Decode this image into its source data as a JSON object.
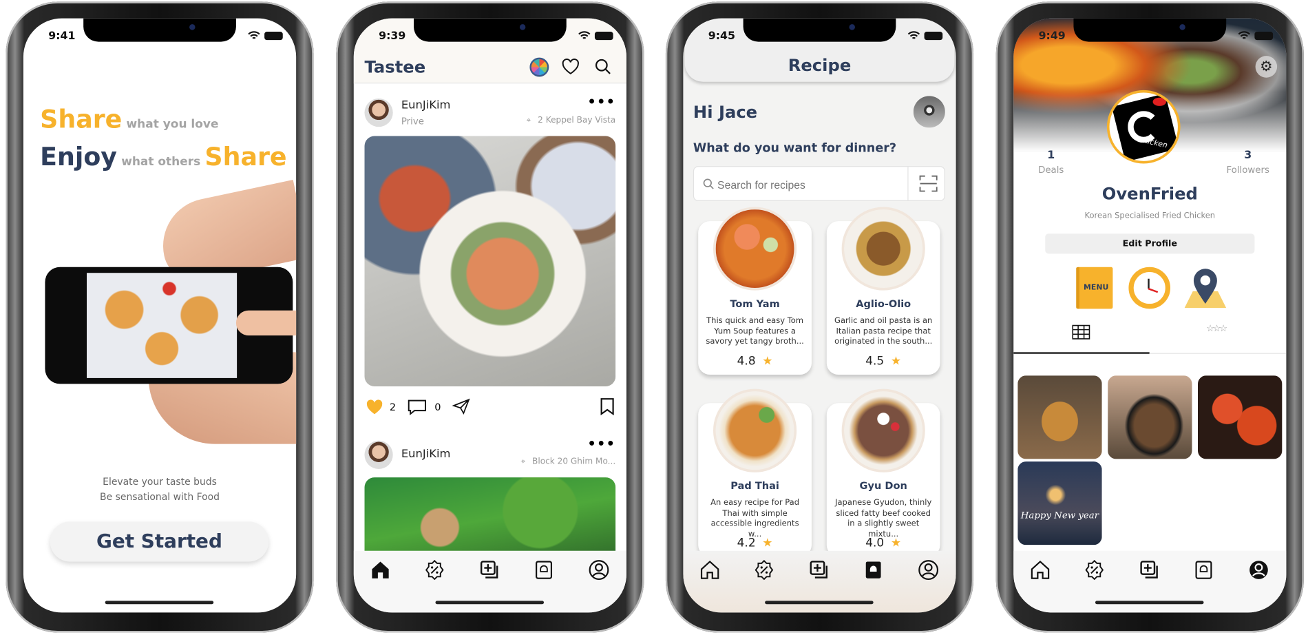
{
  "colors": {
    "accent": "#f7b22c",
    "navy": "#2e3e5c",
    "gray": "#9a9a9a"
  },
  "welcome": {
    "status_time": "9:41",
    "line1_big": "Share",
    "line1_small": "what you love",
    "line2_big": "Enjoy",
    "line2_small": "what others",
    "line2_big2": "Share",
    "tagline1": "Elevate your taste buds",
    "tagline2": "Be sensational with Food",
    "cta": "Get Started"
  },
  "feed": {
    "status_time": "9:39",
    "title": "Tastee",
    "posts": [
      {
        "user": "EunJiKim",
        "subtitle": "Prive",
        "location": "2 Keppel Bay Vista",
        "likes": "2",
        "comments": "0",
        "liked": true
      },
      {
        "user": "EunJiKim",
        "subtitle": "",
        "location": "Block 20 Ghim Mo..."
      }
    ],
    "active_tab": "home"
  },
  "recipe": {
    "status_time": "9:45",
    "title": "Recipe",
    "greeting": "Hi Jace",
    "question": "What do you want for dinner?",
    "search_placeholder": "Search for recipes",
    "cards": [
      {
        "name": "Tom Yam",
        "desc": "This quick and easy Tom Yum Soup features a savory yet tangy broth...",
        "rating": "4.8"
      },
      {
        "name": "Aglio-Olio",
        "desc": "Garlic and oil pasta is an Italian pasta recipe that originated in the south...",
        "rating": "4.5"
      },
      {
        "name": "Pad Thai",
        "desc": "An easy recipe for Pad Thai with simple accessible ingredients w...",
        "rating": "4.2"
      },
      {
        "name": "Gyu Don",
        "desc": "Japanese Gyudon, thinly sliced fatty beef cooked in a slightly sweet mixtu...",
        "rating": "4.0"
      }
    ],
    "active_tab": "recipe"
  },
  "profile": {
    "status_time": "9:49",
    "deals_count": "1",
    "deals_label": "Deals",
    "followers_count": "3",
    "followers_label": "Followers",
    "name": "OvenFried",
    "bio": "Korean Specialised Fried Chicken",
    "edit_button": "Edit Profile",
    "menu_icon_text": "MENU",
    "logo_text": "hicken",
    "grid_photo_caption": "Happy New year",
    "active_tab": "profile"
  }
}
